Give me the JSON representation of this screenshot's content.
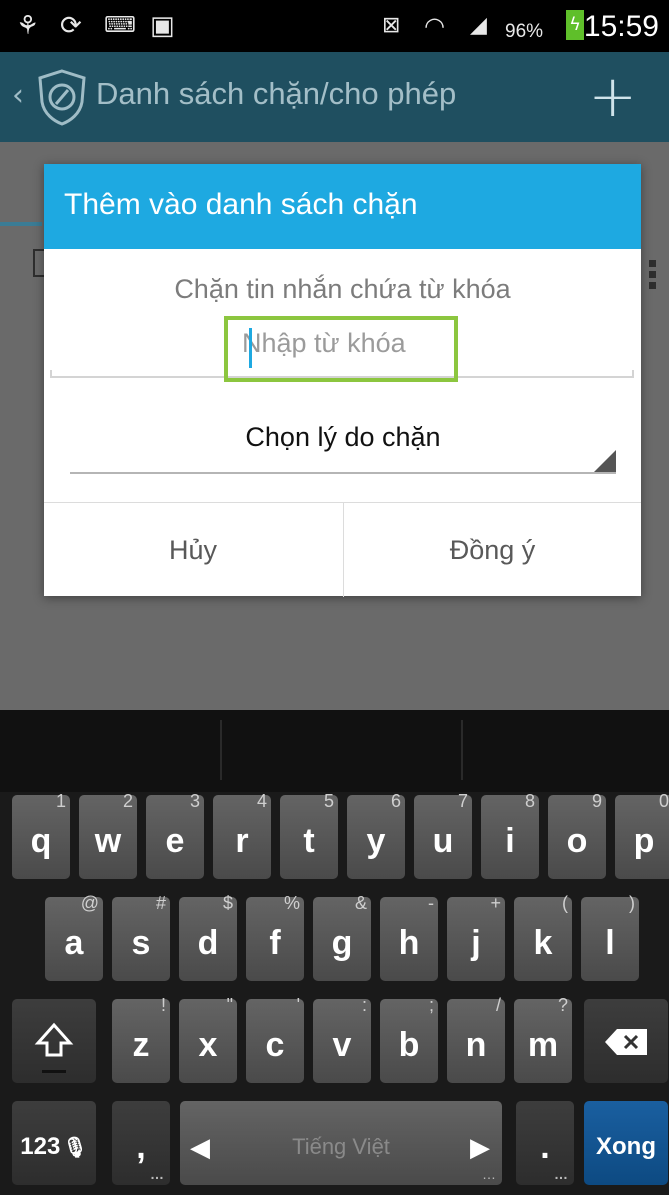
{
  "status_bar": {
    "battery_percent": "96%",
    "time": "15:59"
  },
  "app_bar": {
    "title": "Danh sách chặn/cho phép"
  },
  "dialog": {
    "title": "Thêm vào danh sách chặn",
    "message": "Chặn tin nhắn chứa từ khóa",
    "keyword_input": {
      "value": "",
      "placeholder": "Nhập từ khóa"
    },
    "reason_spinner": {
      "selected": "Chọn lý do chặn"
    },
    "cancel_label": "Hủy",
    "ok_label": "Đồng ý"
  },
  "keyboard": {
    "row1": [
      {
        "label": "q",
        "hint": "1"
      },
      {
        "label": "w",
        "hint": "2"
      },
      {
        "label": "e",
        "hint": "3"
      },
      {
        "label": "r",
        "hint": "4"
      },
      {
        "label": "t",
        "hint": "5"
      },
      {
        "label": "y",
        "hint": "6"
      },
      {
        "label": "u",
        "hint": "7"
      },
      {
        "label": "i",
        "hint": "8"
      },
      {
        "label": "o",
        "hint": "9"
      },
      {
        "label": "p",
        "hint": "0"
      }
    ],
    "row2": [
      {
        "label": "a",
        "hint": "@"
      },
      {
        "label": "s",
        "hint": "#"
      },
      {
        "label": "d",
        "hint": "$"
      },
      {
        "label": "f",
        "hint": "%"
      },
      {
        "label": "g",
        "hint": "&"
      },
      {
        "label": "h",
        "hint": "-"
      },
      {
        "label": "j",
        "hint": "+"
      },
      {
        "label": "k",
        "hint": "("
      },
      {
        "label": "l",
        "hint": ")"
      }
    ],
    "row3": [
      {
        "label": "z",
        "hint": "!"
      },
      {
        "label": "x",
        "hint": "\""
      },
      {
        "label": "c",
        "hint": "'"
      },
      {
        "label": "v",
        "hint": ":"
      },
      {
        "label": "b",
        "hint": ";"
      },
      {
        "label": "n",
        "hint": "/"
      },
      {
        "label": "m",
        "hint": "?"
      }
    ],
    "symbols_label": "123",
    "comma_label": ",",
    "space_label": "Tiếng Việt",
    "period_label": ".",
    "done_label": "Xong"
  }
}
